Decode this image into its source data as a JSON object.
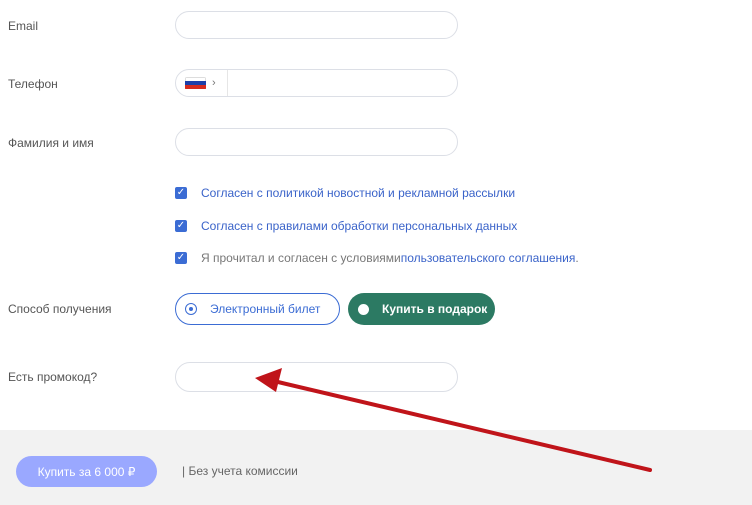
{
  "fields": {
    "email_label": "Email",
    "phone_label": "Телефон",
    "name_label": "Фамилия и имя"
  },
  "phone": {
    "country_flag": "russia-flag-icon",
    "chevron": "›"
  },
  "checkboxes": [
    {
      "text": "Согласен с политикой новостной и рекламной рассылки",
      "checked": true
    },
    {
      "text": "Согласен с правилами обработки персональных данных",
      "checked": true
    },
    {
      "prefix": "Я прочитал и согласен с условиями ",
      "link": "пользовательского соглашения",
      "suffix": ".",
      "checked": true
    }
  ],
  "delivery": {
    "label": "Способ получения",
    "options": [
      {
        "label": "Электронный билет",
        "selected": true
      },
      {
        "label": "Купить в подарок",
        "selected": false
      }
    ]
  },
  "promo": {
    "label": "Есть промокод?"
  },
  "footer": {
    "buy_label": "Купить за  6 000 ₽",
    "fee_note": "| Без учета комиссии"
  },
  "colors": {
    "accent": "#3b6cd4",
    "gift": "#2c7a63",
    "buy": "#9aa8ff",
    "arrow": "#c0141a"
  }
}
